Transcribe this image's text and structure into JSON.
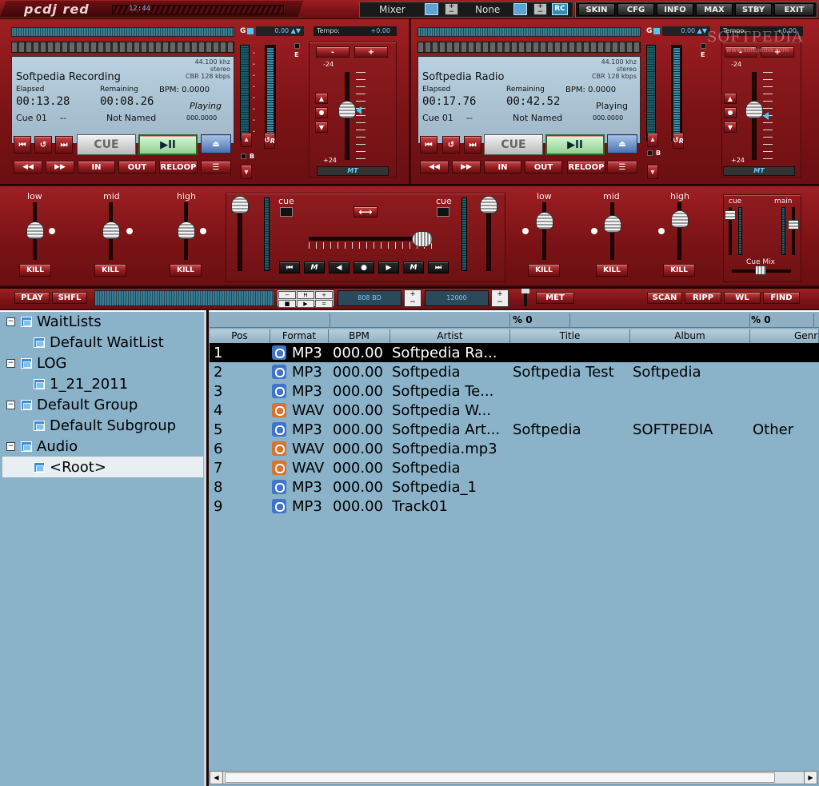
{
  "app": {
    "logo": "pcdj red",
    "clock": "12:44",
    "watermark": "SOFTPEDIA",
    "watermark_url": "www.softpedia.com"
  },
  "topbar": {
    "mixer_label": "Mixer",
    "none_label": "None",
    "rc_label": "RC",
    "buttons": [
      "SKIN",
      "CFG",
      "INFO",
      "MAX",
      "STBY",
      "EXIT"
    ]
  },
  "deck_a": {
    "gain_label": "G",
    "gain_value": "0.00",
    "tempo_label": "Tempo:",
    "tempo_value": "+0.00",
    "freq": "44.100 khz",
    "mode": "stereo",
    "bitrate": "CBR 128 kbps",
    "title": "Softpedia Recording",
    "elapsed_label": "Elapsed",
    "remaining_label": "Remaining",
    "bpm_label": "BPM:",
    "bpm_value": "0.0000",
    "elapsed": "00:13.28",
    "remaining": "00:08.26",
    "status": "Playing",
    "cue": "Cue 01",
    "cue_dash": "--",
    "cue_name": "Not Named",
    "cue_time": "000.0000",
    "pitch_top": "-24",
    "pitch_bottom": "+24",
    "mt": "MT",
    "e_label": "E",
    "b_label": "B",
    "r_label": "R",
    "cue_button": "CUE",
    "play_pause": "▶II",
    "in": "IN",
    "out": "OUT",
    "reloop": "RELOOP",
    "minus": "-",
    "plus": "+"
  },
  "deck_b": {
    "gain_label": "G",
    "gain_value": "0.00",
    "tempo_label": "Tempo:",
    "tempo_value": "+0.00",
    "freq": "44.100 khz",
    "mode": "stereo",
    "bitrate": "CBR 128 kbps",
    "title": "Softpedia Radio",
    "elapsed_label": "Elapsed",
    "remaining_label": "Remaining",
    "bpm_label": "BPM:",
    "bpm_value": "0.0000",
    "elapsed": "00:17.76",
    "remaining": "00:42.52",
    "status": "Playing",
    "cue": "Cue 01",
    "cue_dash": "--",
    "cue_name": "Not Named",
    "cue_time": "000.0000",
    "pitch_top": "-24",
    "pitch_bottom": "+24",
    "mt": "MT",
    "e_label": "E",
    "b_label": "B",
    "r_label": "R",
    "cue_button": "CUE",
    "play_pause": "▶II",
    "in": "IN",
    "out": "OUT",
    "reloop": "RELOOP",
    "minus": "-",
    "plus": "+"
  },
  "mixer": {
    "eq": [
      "low",
      "mid",
      "high"
    ],
    "kill": "KILL",
    "cue": "cue",
    "main": "main",
    "cue_mix": "Cue Mix",
    "crossfader_icon": "⟷",
    "m": "M"
  },
  "bottombar": {
    "play": "PLAY",
    "shfl": "SHFL",
    "bpm_display": "808 BD",
    "value_display": "12000",
    "met": "MET",
    "scan": "SCAN",
    "ripp": "RIPP",
    "wl": "WL",
    "find": "FIND",
    "h_label": "H",
    "eq_label": "="
  },
  "tree": {
    "items": [
      {
        "label": "WaitLists",
        "level": 0
      },
      {
        "label": "Default WaitList",
        "level": 1
      },
      {
        "label": "LOG",
        "level": 0
      },
      {
        "label": "1_21_2011",
        "level": 1
      },
      {
        "label": "Default Group",
        "level": 0
      },
      {
        "label": "Default Subgroup",
        "level": 1
      },
      {
        "label": "Audio",
        "level": 0
      },
      {
        "label": "<Root>",
        "level": 1
      }
    ]
  },
  "table": {
    "percent1": "% 0",
    "percent2": "% 0",
    "columns": [
      "Pos",
      "Format",
      "BPM",
      "Artist",
      "Title",
      "Album",
      "Genre"
    ],
    "rows": [
      {
        "pos": "1",
        "format": "MP3",
        "bpm": "000.00",
        "artist": "Softpedia Ra...",
        "title": "",
        "album": "",
        "genre": "",
        "selected": true
      },
      {
        "pos": "2",
        "format": "MP3",
        "bpm": "000.00",
        "artist": "Softpedia",
        "title": "Softpedia Test",
        "album": "Softpedia",
        "genre": ""
      },
      {
        "pos": "3",
        "format": "MP3",
        "bpm": "000.00",
        "artist": "Softpedia Te...",
        "title": "",
        "album": "",
        "genre": ""
      },
      {
        "pos": "4",
        "format": "WAV",
        "bpm": "000.00",
        "artist": "Softpedia W...",
        "title": "",
        "album": "",
        "genre": ""
      },
      {
        "pos": "5",
        "format": "MP3",
        "bpm": "000.00",
        "artist": "Softpedia Art...",
        "title": "Softpedia",
        "album": "SOFTPEDIA",
        "genre": "Other"
      },
      {
        "pos": "6",
        "format": "WAV",
        "bpm": "000.00",
        "artist": "Softpedia.mp3",
        "title": "",
        "album": "",
        "genre": ""
      },
      {
        "pos": "7",
        "format": "WAV",
        "bpm": "000.00",
        "artist": "Softpedia",
        "title": "",
        "album": "",
        "genre": ""
      },
      {
        "pos": "8",
        "format": "MP3",
        "bpm": "000.00",
        "artist": "Softpedia_1",
        "title": "",
        "album": "",
        "genre": ""
      },
      {
        "pos": "9",
        "format": "MP3",
        "bpm": "000.00",
        "artist": "Track01",
        "title": "",
        "album": "",
        "genre": ""
      }
    ]
  },
  "colors": {
    "mp3_icon": "#3f74c9",
    "wav_icon": "#d9712f",
    "selected_row": "#000000",
    "tree_bg": "#8ab2c8"
  }
}
